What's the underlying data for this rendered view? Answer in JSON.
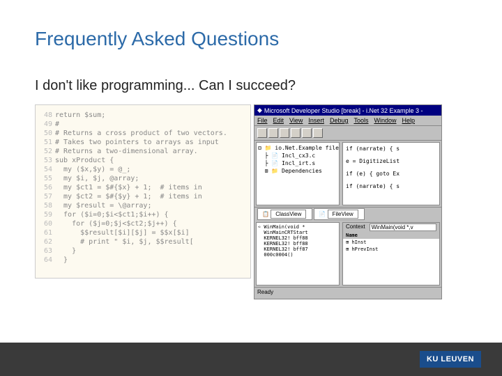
{
  "slide": {
    "title": "Frequently Asked Questions",
    "subtitle": "I don't like programming... Can I succeed?"
  },
  "code_editor": {
    "lines": [
      {
        "n": "48",
        "t": "return $sum;"
      },
      {
        "n": "49",
        "t": "#"
      },
      {
        "n": "50",
        "t": "# Returns a cross product of two vectors."
      },
      {
        "n": "51",
        "t": "# Takes two pointers to arrays as input"
      },
      {
        "n": "52",
        "t": "# Returns a two-dimensional array."
      },
      {
        "n": "53",
        "t": "sub xProduct {"
      },
      {
        "n": "54",
        "t": "  my ($x,$y) = @_;"
      },
      {
        "n": "55",
        "t": "  my $i, $j, @array;"
      },
      {
        "n": "56",
        "t": "  my $ct1 = $#{$x} + 1;  # items in"
      },
      {
        "n": "57",
        "t": "  my $ct2 = $#{$y} + 1;  # items in"
      },
      {
        "n": "58",
        "t": "  my $result = \\@array;"
      },
      {
        "n": "59",
        "t": "  for ($i=0;$i<$ct1;$i++) {"
      },
      {
        "n": "60",
        "t": "    for ($j=0;$j<$ct2;$j++) {"
      },
      {
        "n": "61",
        "t": "      $$result[$i][$j] = $$x[$i]"
      },
      {
        "n": "62",
        "t": "      # print \" $i, $j, $$result["
      },
      {
        "n": "63",
        "t": "    }"
      },
      {
        "n": "64",
        "t": "  }"
      }
    ]
  },
  "ide": {
    "title": "Microsoft Developer Studio [break] - i.Net 32  Example 3 -",
    "menu": [
      "File",
      "Edit",
      "View",
      "Insert",
      "Debug",
      "Tools",
      "Window",
      "Help"
    ],
    "tree": {
      "root": "io.Net.Example file",
      "items": [
        "Incl_cx3.c",
        "Incl_irt.s",
        "Dependencies"
      ]
    },
    "code_view": [
      "if (narrate) { s",
      "",
      "e = DigitizeList",
      "",
      "if (e) { goto Ex",
      "",
      "if (narrate) { s"
    ],
    "tabs": [
      "ClassView",
      "FileView"
    ],
    "stack": [
      "WinMain(void * ",
      "WinMainCRTStart",
      "KERNEL32! bff88",
      "KERNEL32! bff88",
      "KERNEL32! bff87",
      "000c0004()"
    ],
    "watch": {
      "header": [
        "Context",
        "WinMain(void *,v"
      ],
      "name_hdr": "Name",
      "rows": [
        "hInst",
        "hPrevInst"
      ]
    },
    "status": "Ready"
  },
  "footer": {
    "logo": "KU LEUVEN"
  }
}
